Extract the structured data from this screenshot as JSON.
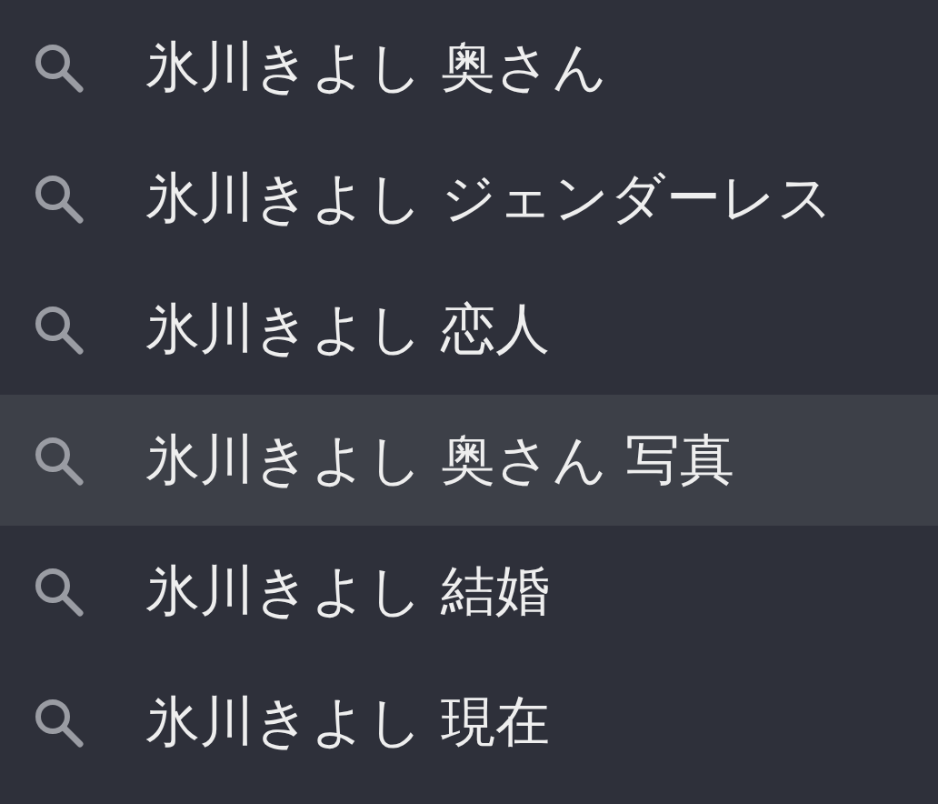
{
  "suggestions": [
    {
      "text": "氷川きよし 奥さん",
      "selected": false
    },
    {
      "text": "氷川きよし ジェンダーレス",
      "selected": false
    },
    {
      "text": "氷川きよし 恋人",
      "selected": false
    },
    {
      "text": "氷川きよし 奥さん 写真",
      "selected": true
    },
    {
      "text": "氷川きよし 結婚",
      "selected": false
    },
    {
      "text": "氷川きよし 現在",
      "selected": false
    }
  ]
}
